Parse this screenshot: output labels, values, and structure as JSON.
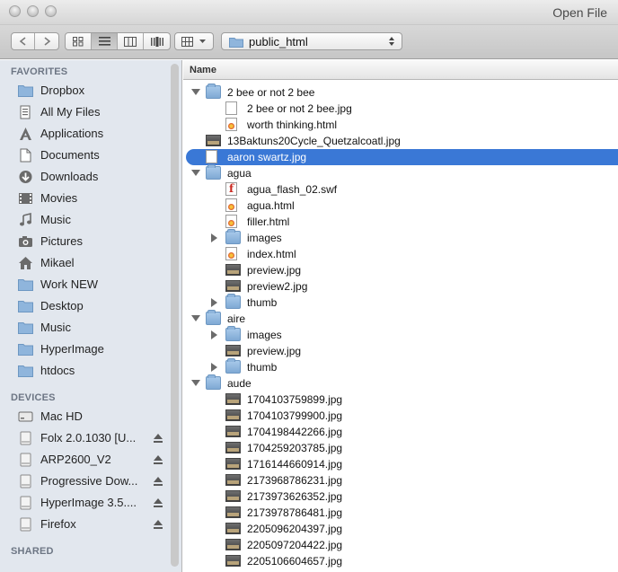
{
  "window": {
    "title": "Open File"
  },
  "toolbar": {
    "location": "public_html"
  },
  "sidebar": {
    "favorites_header": "FAVORITES",
    "favorites": [
      {
        "label": "Dropbox",
        "icon": "folder-icon"
      },
      {
        "label": "All My Files",
        "icon": "all-files-icon"
      },
      {
        "label": "Applications",
        "icon": "applications-icon"
      },
      {
        "label": "Documents",
        "icon": "documents-icon"
      },
      {
        "label": "Downloads",
        "icon": "downloads-icon"
      },
      {
        "label": "Movies",
        "icon": "movies-icon"
      },
      {
        "label": "Music",
        "icon": "music-icon"
      },
      {
        "label": "Pictures",
        "icon": "pictures-icon"
      },
      {
        "label": "Mikael",
        "icon": "home-icon"
      },
      {
        "label": "Work NEW",
        "icon": "folder-icon"
      },
      {
        "label": "Desktop",
        "icon": "folder-icon"
      },
      {
        "label": "Music",
        "icon": "folder-icon"
      },
      {
        "label": "HyperImage",
        "icon": "folder-icon"
      },
      {
        "label": "htdocs",
        "icon": "folder-icon"
      }
    ],
    "devices_header": "DEVICES",
    "devices": [
      {
        "label": "Mac HD",
        "eject": false
      },
      {
        "label": "Folx 2.0.1030 [U...",
        "eject": true
      },
      {
        "label": "ARP2600_V2",
        "eject": true
      },
      {
        "label": "Progressive Dow...",
        "eject": true
      },
      {
        "label": "HyperImage 3.5....",
        "eject": true
      },
      {
        "label": "Firefox",
        "eject": true
      }
    ],
    "shared_header": "SHARED"
  },
  "list": {
    "column_name": "Name",
    "rows": [
      {
        "label": "2 bee or not 2 bee",
        "type": "folder",
        "depth": 0,
        "disclosure": "open",
        "selected": false
      },
      {
        "label": "2 bee or not 2 bee.jpg",
        "type": "doc",
        "depth": 1,
        "disclosure": "",
        "selected": false
      },
      {
        "label": "worth thinking.html",
        "type": "html",
        "depth": 1,
        "disclosure": "",
        "selected": false
      },
      {
        "label": "13Baktuns20Cycle_Quetzalcoatl.jpg",
        "type": "image",
        "depth": 0,
        "disclosure": "",
        "selected": false
      },
      {
        "label": "aaron swartz.jpg",
        "type": "doc",
        "depth": 0,
        "disclosure": "",
        "selected": true
      },
      {
        "label": "agua",
        "type": "folder",
        "depth": 0,
        "disclosure": "open",
        "selected": false
      },
      {
        "label": "agua_flash_02.swf",
        "type": "swf",
        "depth": 1,
        "disclosure": "",
        "selected": false
      },
      {
        "label": "agua.html",
        "type": "html",
        "depth": 1,
        "disclosure": "",
        "selected": false
      },
      {
        "label": "filler.html",
        "type": "html",
        "depth": 1,
        "disclosure": "",
        "selected": false
      },
      {
        "label": "images",
        "type": "folder",
        "depth": 1,
        "disclosure": "closed",
        "selected": false
      },
      {
        "label": "index.html",
        "type": "html",
        "depth": 1,
        "disclosure": "",
        "selected": false
      },
      {
        "label": "preview.jpg",
        "type": "image",
        "depth": 1,
        "disclosure": "",
        "selected": false
      },
      {
        "label": "preview2.jpg",
        "type": "image",
        "depth": 1,
        "disclosure": "",
        "selected": false
      },
      {
        "label": "thumb",
        "type": "folder",
        "depth": 1,
        "disclosure": "closed",
        "selected": false
      },
      {
        "label": "aire",
        "type": "folder",
        "depth": 0,
        "disclosure": "open",
        "selected": false
      },
      {
        "label": "images",
        "type": "folder",
        "depth": 1,
        "disclosure": "closed",
        "selected": false
      },
      {
        "label": "preview.jpg",
        "type": "image",
        "depth": 1,
        "disclosure": "",
        "selected": false
      },
      {
        "label": "thumb",
        "type": "folder",
        "depth": 1,
        "disclosure": "closed",
        "selected": false
      },
      {
        "label": "aude",
        "type": "folder",
        "depth": 0,
        "disclosure": "open",
        "selected": false
      },
      {
        "label": "1704103759899.jpg",
        "type": "image",
        "depth": 1,
        "disclosure": "",
        "selected": false
      },
      {
        "label": "1704103799900.jpg",
        "type": "image",
        "depth": 1,
        "disclosure": "",
        "selected": false
      },
      {
        "label": "1704198442266.jpg",
        "type": "image",
        "depth": 1,
        "disclosure": "",
        "selected": false
      },
      {
        "label": "1704259203785.jpg",
        "type": "image",
        "depth": 1,
        "disclosure": "",
        "selected": false
      },
      {
        "label": "1716144660914.jpg",
        "type": "image",
        "depth": 1,
        "disclosure": "",
        "selected": false
      },
      {
        "label": "2173968786231.jpg",
        "type": "image",
        "depth": 1,
        "disclosure": "",
        "selected": false
      },
      {
        "label": "2173973626352.jpg",
        "type": "image",
        "depth": 1,
        "disclosure": "",
        "selected": false
      },
      {
        "label": "2173978786481.jpg",
        "type": "image",
        "depth": 1,
        "disclosure": "",
        "selected": false
      },
      {
        "label": "2205096204397.jpg",
        "type": "image",
        "depth": 1,
        "disclosure": "",
        "selected": false
      },
      {
        "label": "2205097204422.jpg",
        "type": "image",
        "depth": 1,
        "disclosure": "",
        "selected": false
      },
      {
        "label": "2205106604657.jpg",
        "type": "image",
        "depth": 1,
        "disclosure": "",
        "selected": false
      }
    ]
  }
}
